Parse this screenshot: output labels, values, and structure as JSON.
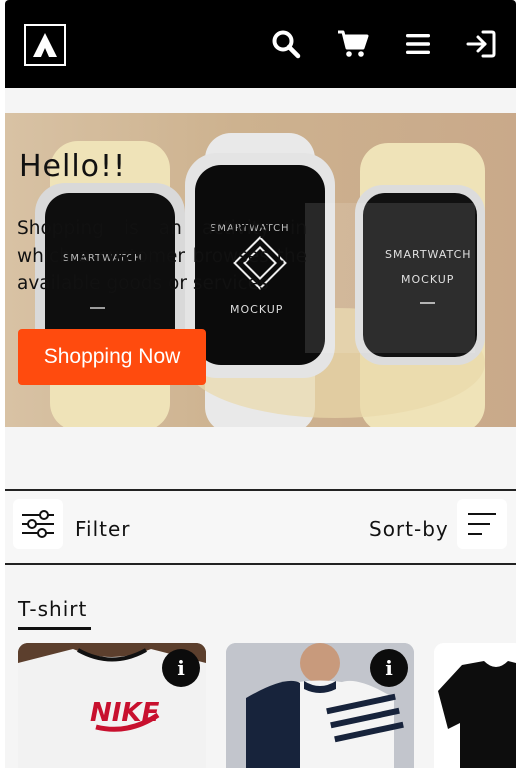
{
  "header": {
    "logo_icon": "a-logo-icon",
    "icons": [
      "search-icon",
      "cart-icon",
      "menu-icon",
      "login-icon"
    ]
  },
  "hero": {
    "title": "Hello!!",
    "text": "Shopping is an activity in which a customer browses the available goods or services",
    "button_label": "Shopping Now",
    "button_color": "#ff4b0e",
    "watch_labels": {
      "left": "SMARTWATCH",
      "center_top": "SMARTWATCH",
      "center": "MOCKUP",
      "right_top": "SMARTWATCH",
      "right": "MOCKUP"
    }
  },
  "filterbar": {
    "filter_label": "Filter",
    "sort_label": "Sort-by"
  },
  "category": {
    "title": "T-shirt",
    "products": [
      {
        "brand_text": "NIKE",
        "info_icon": "info-icon"
      },
      {
        "info_icon": "info-icon"
      },
      {}
    ]
  }
}
